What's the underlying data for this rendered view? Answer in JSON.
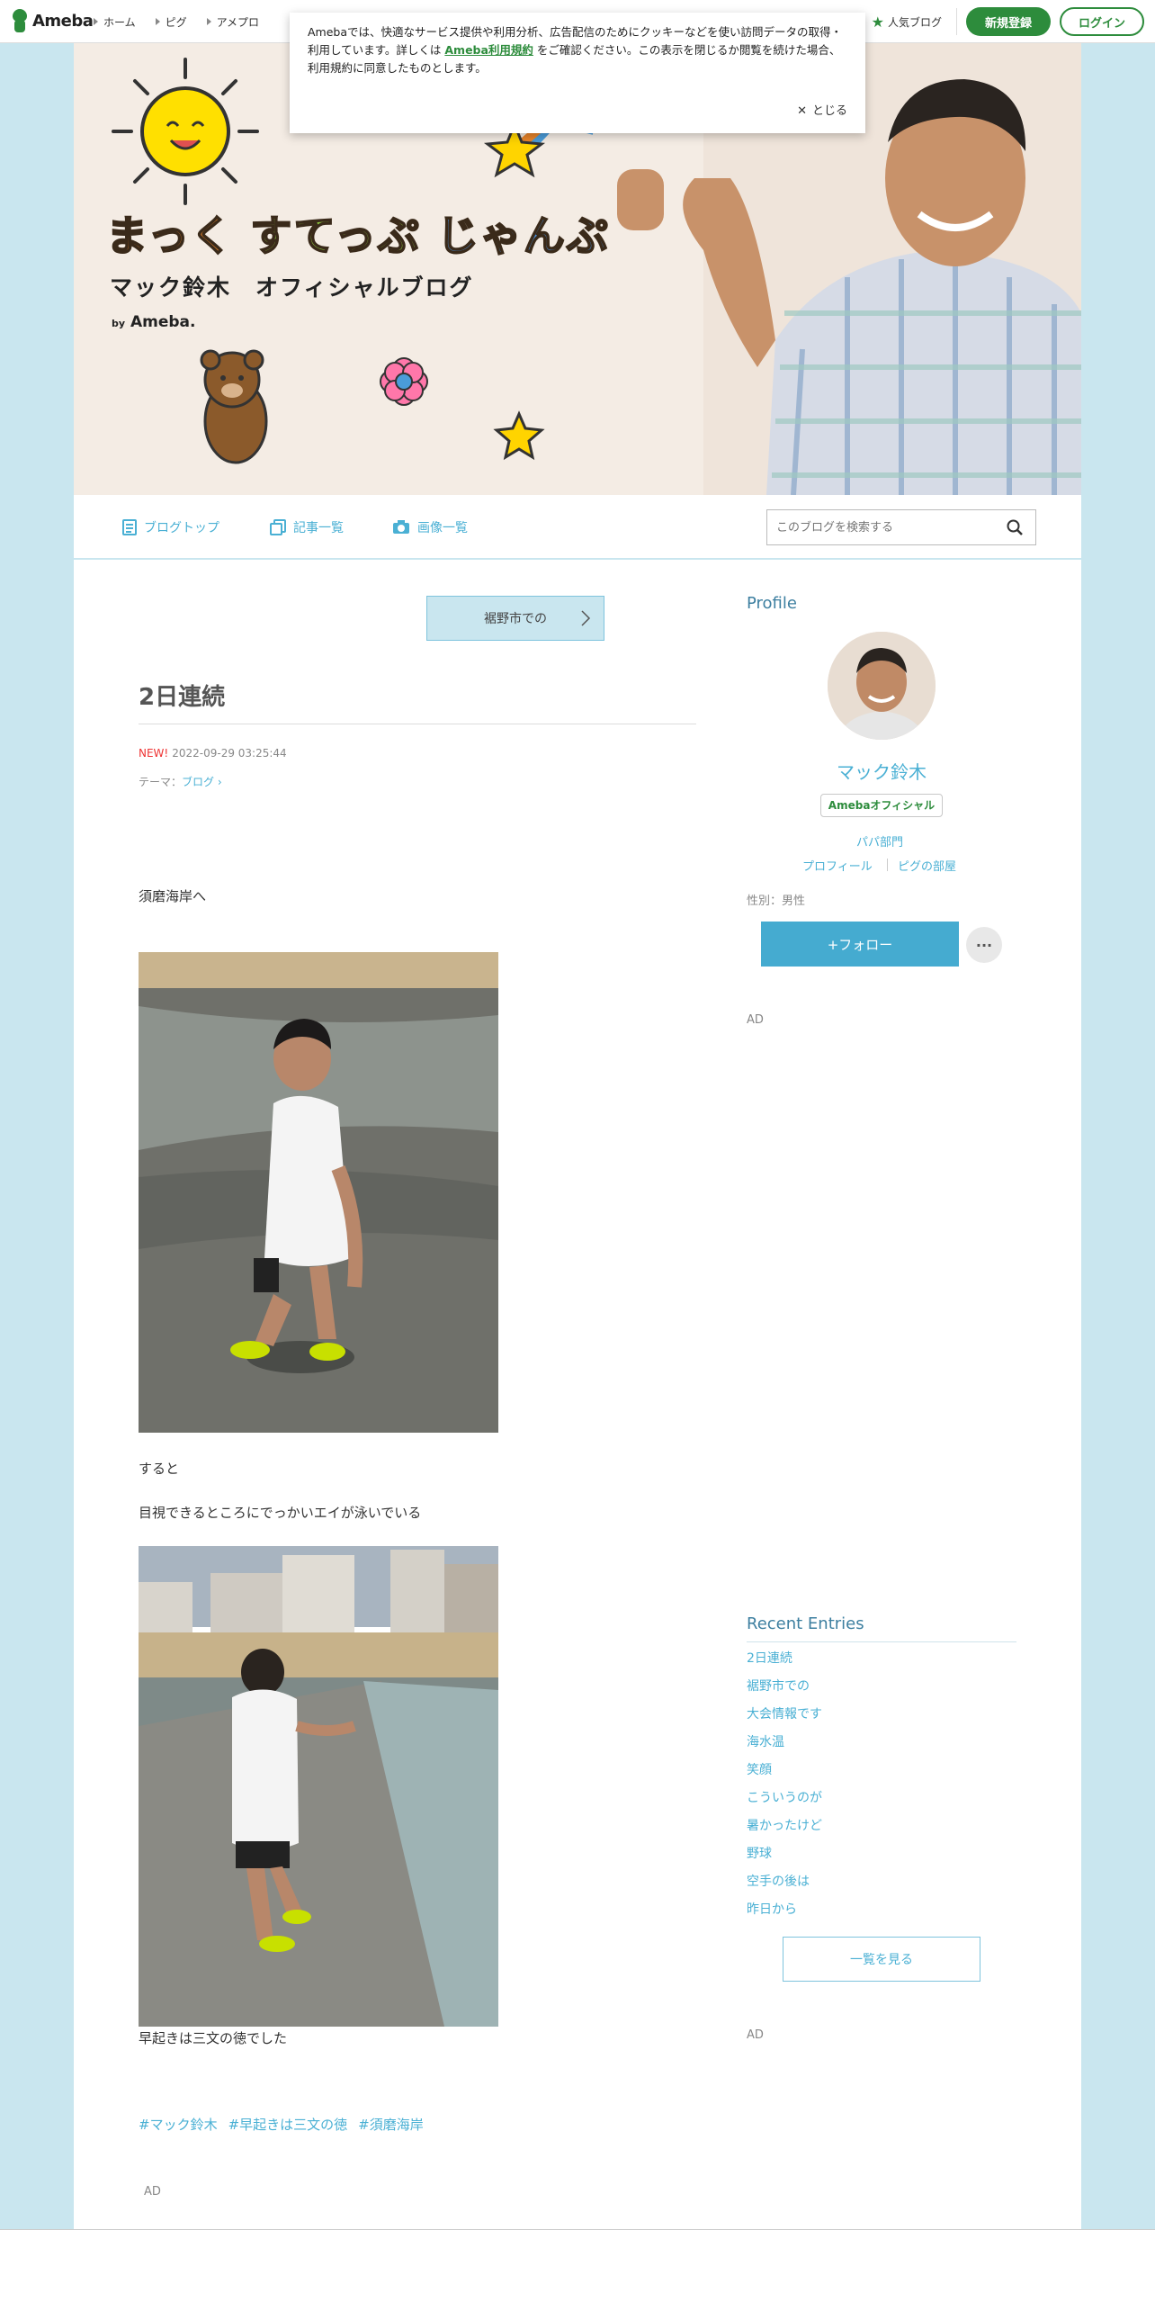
{
  "globalbar": {
    "logo": "Ameba",
    "nav": [
      "ホーム",
      "ピグ",
      "アメプロ"
    ],
    "popular": "人気ブログ",
    "register": "新規登録",
    "login": "ログイン"
  },
  "cookie": {
    "text_before": "Amebaでは、快適なサービス提供や利用分析、広告配信のためにクッキーなどを使い訪問データの取得・利用しています。詳しくは",
    "link": "Ameba利用規約",
    "text_after": "をご確認ください。この表示を閉じるか閲覧を続けた場合、利用規約に同意したものとします。",
    "close": "とじる"
  },
  "banner": {
    "title_a": "まっく",
    "title_b": "すてっぷ",
    "title_c": "じゃんぷ",
    "subtitle": "マック鈴木　オフィシャルブログ",
    "by": "by",
    "brand": "Ameba."
  },
  "blognav": {
    "top": "ブログトップ",
    "entries": "記事一覧",
    "images": "画像一覧",
    "search_placeholder": "このブログを検索する"
  },
  "article": {
    "prev_label": "裾野市での",
    "title": "2日連続",
    "new_label": "NEW!",
    "date": "2022-09-29 03:25:44",
    "theme_label": "テーマ：",
    "theme": "ブログ",
    "para1": "須磨海岸へ",
    "para2": "すると",
    "para3": "目視できるところにでっかいエイが泳いでいる",
    "para4": "早起きは三文の徳でした",
    "tags": [
      "#マック鈴木",
      "#早起きは三文の徳",
      "#須磨海岸"
    ],
    "ad": "AD"
  },
  "sidebar": {
    "profile_heading": "Profile",
    "name": "マック鈴木",
    "official_badge": "Amebaオフィシャル",
    "category": "パパ部門",
    "profile_link": "プロフィール",
    "pig_link": "ピグの部屋",
    "gender": "性別：男性",
    "follow": "+フォロー",
    "more": "···",
    "ad1": "AD",
    "recent_heading": "Recent Entries",
    "recent": [
      "2日連続",
      "裾野市での",
      "大会情報です",
      "海水温",
      "笑顔",
      "こういうのが",
      "暑かったけど",
      "野球",
      "空手の後は",
      "昨日から"
    ],
    "see_all": "一覧を見る",
    "ad2": "AD"
  },
  "colors": {
    "ameba_green": "#2d8c3c",
    "accent_blue": "#4ab0d4",
    "side_bg": "#c9e6ef"
  }
}
